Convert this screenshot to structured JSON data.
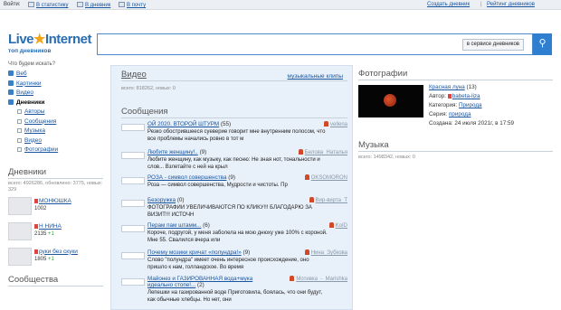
{
  "topbar": {
    "login_label": "Войти:",
    "links": [
      "В статистику",
      "В дневник",
      "В почту"
    ],
    "create": "Создать дневник",
    "rating": "Рейтинг дневников"
  },
  "logo": {
    "main": "Live",
    "star": "★",
    "rest": "Internet",
    "sub": "топ дневников"
  },
  "search": {
    "placeholder": "",
    "service_button": "в сервисе дневников"
  },
  "left": {
    "question": "Что будем искать?",
    "nav": [
      {
        "label": "Веб"
      },
      {
        "label": "Картинки"
      },
      {
        "label": "Видео"
      },
      {
        "label": "Дневники"
      }
    ],
    "subnav": [
      "Авторы",
      "Сообщения",
      "Музыка",
      "Видео",
      "Фотографии"
    ],
    "diaries_title": "Дневники",
    "diaries_stats": "всего: 4926286, обновлено: 3775, новых: 329",
    "diaries": [
      {
        "name": "МОНЮШКА",
        "count": "1002",
        "delta": ""
      },
      {
        "name": "Н НИНА",
        "count": "2135",
        "delta": "+1"
      },
      {
        "name": "руки без скуки",
        "count": "1805",
        "delta": "+1"
      }
    ],
    "communities_title": "Сообщества"
  },
  "video": {
    "title": "Видео",
    "clips_link": "музыкальные клипы",
    "stats": "всего: 818262, новых: 0"
  },
  "messages": {
    "title": "Сообщения",
    "posts": [
      {
        "title": "ОЙ 2020. ВТОРОЙ ШТУРМ",
        "count": "(55)",
        "author": "vellena",
        "text": "Резко обострившееся суеверие говорит мне внутренним полосом, что все проблемы начались ровно в тот м"
      },
      {
        "title": "Любите женщину!..",
        "count": "(9)",
        "author": "Белова_Наталья",
        "text": "Любите женщину, как музыку, как песню: Не зная нот, тональности и слов... Взлетайте с ней на крыл"
      },
      {
        "title": "РОЗА - символ совершенства",
        "count": "(9)",
        "author": "OKSOMORON",
        "text": " Роза — символ совершенства, Мудрости и чистоты. Пр"
      },
      {
        "title": "Безоружка",
        "count": "(0)",
        "author": "Вир-вирта_T",
        "text": "ФОТОГРАФИИ УВЕЛИЧИВАЮТСЯ ПО КЛИКУ!!! БЛАГОДАРЮ ЗА ВИЗИТ!!! ИСТОЧН"
      },
      {
        "title": "Перам пам штамм...",
        "count": "(6)",
        "author": "KoID",
        "text": "Короче, подругой, у меня заболела на мою днюху уже 100% с короной. Мне 55. Свалился вчера или"
      },
      {
        "title": "Почему мозики кричат «полундра!»",
        "count": "(9)",
        "author": "Нина_Зубкова",
        "text": "Слово \"полундра\" имеет очень интересное происхождение, оно пришло к нам, голландское. Во время"
      },
      {
        "title": "Майонез и ГАЗИРОВАННАЯ вода+мука идеально стопе!...",
        "count": "(2)",
        "author": "Мотивка_-_Marishka",
        "text": "Лепешки на газированной воде Приготовила, боялась, что они будут, как обычные хлебцы. Но нет, они"
      }
    ]
  },
  "photos": {
    "title": "Фотографии",
    "post_title": "Красная луна",
    "post_count": "(13)",
    "author_label": "Автор:",
    "author": "babeta-liza",
    "category_label": "Категория:",
    "category": "Природа",
    "series_label": "Серия:",
    "series": "природа",
    "created": "Создана: 24 июля 2021г, в 17:59"
  },
  "music": {
    "title": "Музыка",
    "stats": "всего: 1498342, новых: 0"
  }
}
